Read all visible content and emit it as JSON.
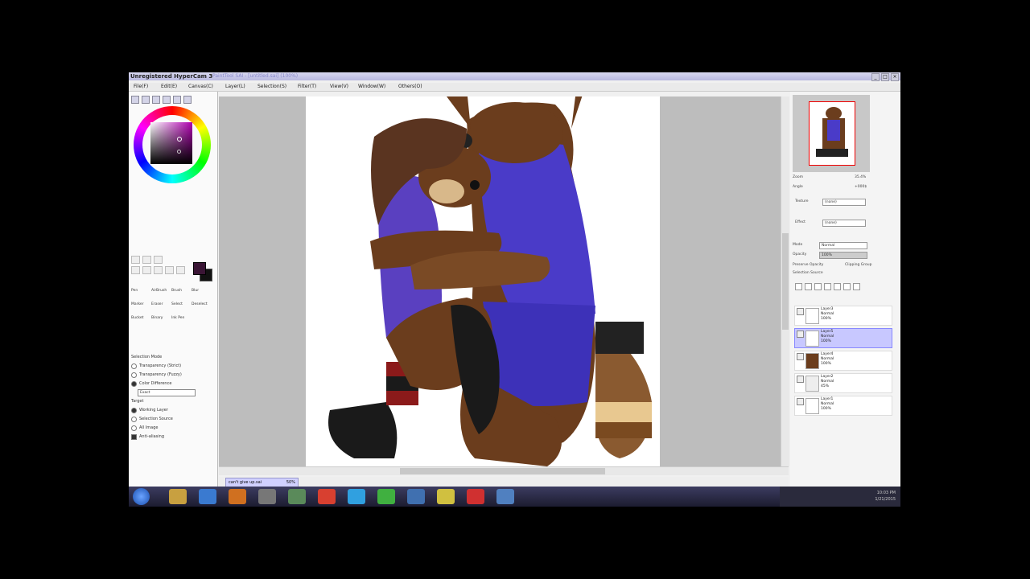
{
  "window": {
    "title": "Unregistered HyperCam 3",
    "subtitle": "PaintTool SAI - [untitled.sai] (100%)",
    "controls": [
      "_",
      "□",
      "×"
    ]
  },
  "menu": [
    {
      "label": "File(F)"
    },
    {
      "label": "Edit(E)"
    },
    {
      "label": "Canvas(C)"
    },
    {
      "label": "Layer(L)"
    },
    {
      "label": "Selection(S)"
    },
    {
      "label": "Filter(T)"
    },
    {
      "label": "View(V)"
    },
    {
      "label": "Window(W)"
    },
    {
      "label": "Others(O)"
    }
  ],
  "colors": {
    "primary": "#3a1535",
    "secondary": "#111111",
    "selected_layer": "#c8c8ff"
  },
  "tools": {
    "labels": [
      "Pen",
      "AirBrush",
      "Brush",
      "Blur",
      "Marker",
      "Eraser",
      "Select",
      "Deselect",
      "Bucket",
      "Binary",
      "Ink Pen",
      ""
    ],
    "selection_mode_title": "Selection Mode",
    "selection_modes": [
      {
        "label": "Transparency (Strict)",
        "checked": false
      },
      {
        "label": "Transparency (Fuzzy)",
        "checked": false
      },
      {
        "label": "Color Difference",
        "checked": true
      }
    ],
    "color_diff_value": "Exact",
    "target_title": "Target",
    "targets": [
      {
        "label": "Working Layer",
        "checked": true
      },
      {
        "label": "Selection Source",
        "checked": false
      },
      {
        "label": "All Image",
        "checked": false
      }
    ],
    "antialias_label": "Anti-aliasing",
    "antialias": true
  },
  "canvas_tab": {
    "name": "can't give up.sai",
    "zoom": "50%"
  },
  "right_panel": {
    "zoom_label": "Zoom",
    "zoom_value": "35.4%",
    "angle_label": "Angle",
    "angle_value": "+000$",
    "texture_label": "Texture",
    "texture_value": "(none)",
    "effect_label": "Effect",
    "effect_value": "(none)",
    "mode_label": "Mode",
    "mode_value": "Normal",
    "opacity_label": "Opacity",
    "opacity_value": "100%",
    "preserve_opacity": "Preserve Opacity",
    "clipping_group": "Clipping Group",
    "selection_source": "Selection Source"
  },
  "layers": [
    {
      "name": "Layer3",
      "mode": "Normal",
      "opacity": "100%",
      "selected": false
    },
    {
      "name": "Layer5",
      "mode": "Normal",
      "opacity": "100%",
      "selected": true
    },
    {
      "name": "Layer4",
      "mode": "Normal",
      "opacity": "100%",
      "selected": false
    },
    {
      "name": "Layer2",
      "mode": "Normal",
      "opacity": "45%",
      "selected": false
    },
    {
      "name": "Layer1",
      "mode": "Normal",
      "opacity": "100%",
      "selected": false
    }
  ],
  "taskbar": {
    "icons": [
      "windows-start-icon",
      "explorer-icon",
      "ie-icon",
      "media-player-icon",
      "sai-icon",
      "app-icon",
      "chrome-icon",
      "skype-icon",
      "hypercam-icon",
      "app2-icon",
      "app3-icon",
      "app4-icon",
      "app5-icon"
    ],
    "time": "10:03 PM",
    "date": "1/21/2015"
  }
}
